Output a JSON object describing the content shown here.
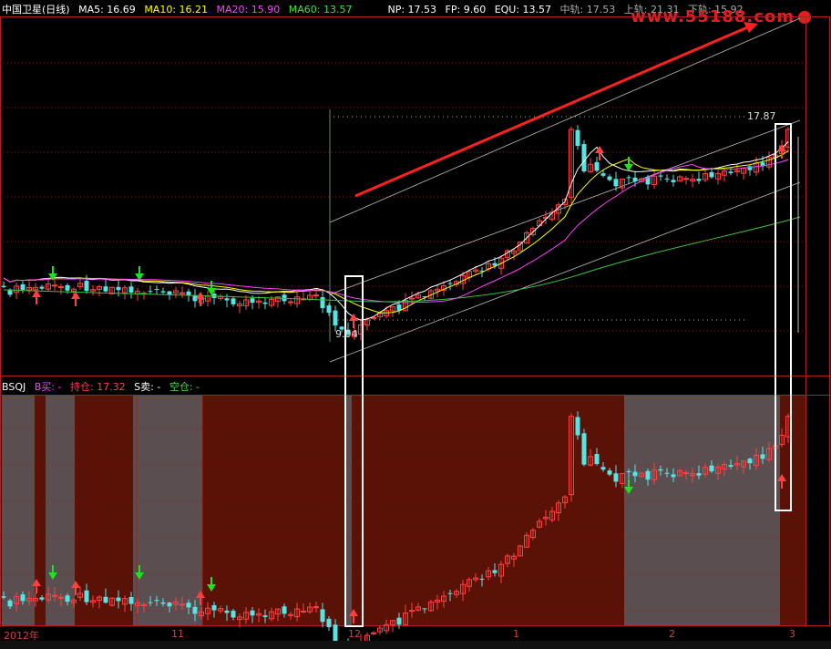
{
  "header": {
    "title": "中国卫星(日线)",
    "ma5": "MA5: 16.69",
    "ma10": "MA10: 16.21",
    "ma20": "MA20: 15.90",
    "ma60": "MA60: 13.57",
    "np": "NP: 17.53",
    "fp": "FP: 9.60",
    "equ": "EQU: 13.57",
    "mid": "中轨: 17.53",
    "upper": "上轨: 21.31",
    "lower": "下轨: 15.92"
  },
  "watermark": "www.55188.com",
  "price_labels": {
    "high": "17.87",
    "low": "9.04"
  },
  "indicator": {
    "name": "BSQJ",
    "buy": "B买: -",
    "hold": "持仓: 17.32",
    "sell": "S卖: -",
    "empty": "空仓: -"
  },
  "axis": {
    "labels": [
      "2012年",
      "11",
      "12",
      "1",
      "2",
      "3"
    ]
  },
  "colors": {
    "up": "#ff4040",
    "down": "#55e5e5",
    "ma5": "#ffffff",
    "ma10": "#ffff00",
    "ma20": "#ff40ff",
    "ma60": "#40c040",
    "hold_bg": "#5a1206",
    "empty_bg": "#5a4e50",
    "buy_arrow": "#ff4040",
    "sell_arrow": "#20e020"
  }
}
